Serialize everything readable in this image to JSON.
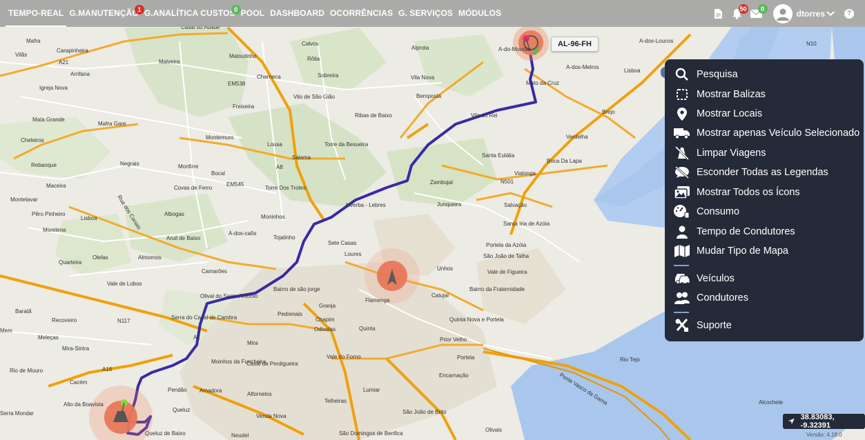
{
  "nav": {
    "items": [
      {
        "label": "TEMPO-REAL",
        "active": true
      },
      {
        "label": "G.MANUTENÇÃO",
        "badge": "1",
        "badge_color": "#d9302c"
      },
      {
        "label": "G.ANALÍTICA CUSTOS",
        "badge": "0",
        "badge_color": "#5cb85c"
      },
      {
        "label": "POOL"
      },
      {
        "label": "DASHBOARD"
      },
      {
        "label": "OCORRÊNCIAS"
      },
      {
        "label": "G. SERVIÇOS"
      },
      {
        "label": "MÓDULOS"
      }
    ]
  },
  "header": {
    "document_icon": "document-icon",
    "notifications": {
      "icon": "bell-icon",
      "badge": "50"
    },
    "messages": {
      "icon": "envelope-icon",
      "badge": "0"
    },
    "user": {
      "name": "dtorres"
    },
    "help": "?"
  },
  "side_menu": {
    "items": [
      {
        "icon": "search-icon",
        "label": "Pesquisa"
      },
      {
        "icon": "dashed-square-icon",
        "label": "Mostrar Balizas"
      },
      {
        "icon": "map-pin-icon",
        "label": "Mostrar Locais"
      },
      {
        "icon": "truck-icon",
        "label": "Mostrar apenas Veículo Selecionado"
      },
      {
        "icon": "road-off-icon",
        "label": "Limpar Viagens"
      },
      {
        "icon": "comment-off-icon",
        "label": "Esconder Todas as Legendas"
      },
      {
        "icon": "images-icon",
        "label": "Mostrar Todos os Ícons"
      },
      {
        "icon": "gauge-icon",
        "label": "Consumo"
      },
      {
        "icon": "person-icon",
        "label": "Tempo de Condutores"
      },
      {
        "icon": "map-icon",
        "label": "Mudar Tipo de Mapa"
      },
      {
        "icon": "car-icon",
        "label": "Veículos"
      },
      {
        "icon": "people-icon",
        "label": "Condutores"
      },
      {
        "icon": "tools-icon",
        "label": "Suporte"
      }
    ]
  },
  "map": {
    "vehicle_plate": "AL-96-FH",
    "coordinates": "38.83083, -9.32391",
    "attribution": "Versão: 4.18.0",
    "labels": {
      "Mafra": "Mafra",
      "Vilas": "Vilãs",
      "Carapinheira": "Carapinheira",
      "Malveira": "Malveira",
      "Matoutinho": "Matoutinho",
      "Calvos": "Calvos",
      "Rolia": "Rôlia",
      "Sobreira": "Sobreira",
      "Alprota": "Alprota",
      "ADoMourao": "A-do-Mourão",
      "ADosLoucos": "A-dos-Loucos",
      "ADosMelros": "A-dos-Melros",
      "Arrifana": "Arrifana",
      "IgrejaNova": "Igreja Nova",
      "Charneca": "Charneca",
      "VilaNova": "Vila Nova",
      "MatoDaCruz": "Mato da Cruz",
      "Bemposta": "Bemposta",
      "VilaDoRei": "Vila do Rei",
      "Brejo": "Brejo",
      "Freixeira": "Freixeira",
      "ViloDeSaoGiao": "Vilo de São Gião",
      "RibasDeBaixo": "Ribas de Baixo",
      "MataGrande": "Mata Grande",
      "MafraGare": "Mafra Gare",
      "Cheleiros": "Cheleiros",
      "Montemuro": "Montemuro",
      "Lousa": "Lousa",
      "TorreDaBesueira": "Torre da Besueira",
      "SantaEulalia": "Santa Eulália",
      "Verdelha": "Verdelha",
      "Rebanque": "Rebanque",
      "Negrais": "Negrais",
      "Monfirre": "Monfirre",
      "Bocal": "Bocal",
      "Salema": "Salema",
      "BocaDaLapa": "Boca Da Lapa",
      "Vialonga": "Vialonga",
      "Maceira": "Maceira",
      "CovasDeFerro": "Covas de Ferro",
      "TorreDosTrotes": "Torre Dos Trotes",
      "Zambujal": "Zambujal",
      "Montelavar": "Montelavar",
      "PeroPinheiro": "Pêro Pinheiro",
      "Albogas": "Albogas",
      "Moninhos": "Moninhos",
      "AlverbaLebres": "Alverba - Lebres",
      "Junqueira": "Junqueira",
      "Salvacao": "Salvação",
      "Morelena": "Morelena",
      "ADosCaos": "A-dos-caõs",
      "AruilDeBaixo": "Aruil de Baixo",
      "Tojalinho": "Tojalinho",
      "SantaIriaDeAzoia": "Santa Iria de Azóia",
      "SeteCasas": "Sete Casas",
      "PortelaDaAzoia": "Portela da Azóia",
      "Olelas": "Olelas",
      "Almornos": "Almornos",
      "Loures": "Loures",
      "Quarteira": "Quarteira",
      "Unhos": "Unhos",
      "SaoJoaoDeTalha": "São João de Talha",
      "ValeDeLobos": "Vale de Lobos",
      "Camaroes": "Camarões",
      "BairroDeSaoJorge": "Bairro de são jorge",
      "Flamenga": "Flamenga",
      "Catujal": "Catujal",
      "ValeDeFigueira": "Vale de Figueira",
      "BairroDaFraternidade": "Bairro da Fraternidade",
      "OlivalDeSantoAntonio": "Olival do Santo António",
      "Granja": "Granja",
      "Barata": "Baratã",
      "Recoveiro": "Recoveiro",
      "SerraDoCasalDeCambra": "Serra do Casal de Cambra",
      "Pedrenais": "Pedrenais",
      "Chapim": "Chapim",
      "QuintaNovaEPortela": "Quinta Nova e Portela",
      "Mem": "Mem",
      "Meleças": "Meleças",
      "MiraSintra": "Mira-Sintra",
      "Odivelas": "Odivelas",
      "Quinta": "Quinta",
      "PriorVelho": "Prior Velho",
      "Mira": "Mira",
      "ValeDoForno": "Vale do Forno",
      "Portela": "Portela",
      "RioTejo": "Rio Tejo",
      "RioDeMouro": "Rio de Mouro",
      "MoinhosDaFuncheira": "Moinhos da Funcheira",
      "CasalDaPerdigueira": "Casal da Perdigueira",
      "Encarnacao": "Encarnação",
      "Cacem": "Cacém",
      "Pendao": "Pendão",
      "Amadora": "Amadora",
      "Alfornelos": "Alfornelos",
      "Lumiar": "Lumiar",
      "AltoDaBoavista": "Alto da Boavista",
      "Telheiras": "Telheiras",
      "Alcochete": "Alcochete",
      "Queluz": "Queluz",
      "VendaNova": "Venda Nova",
      "SaoJoaoDeBrito": "São João de Brito",
      "PonteVascoDaGama": "Ponte Vasco da Gama",
      "QueluzDeBaixo": "Queluz de Baixo",
      "Neudel": "Neudel",
      "SaoDomingosDeBenfica": "São Domingos de Benfica",
      "Olivais": "Olivais",
      "SerraMondar": "Serra Mondar",
      "Lisboa": "Lisboa",
      "Lisbo2": "Lisboa",
      "A1": "A1",
      "A8": "A8",
      "A16": "A16",
      "A21": "A21",
      "N10": "N10",
      "N117": "N117",
      "N501": "N501",
      "EM538": "EM538",
      "EM545": "EM545",
      "RuaDosCanais": "Rua dos Canais",
      "CasalDoAbade": "Casal do Abade"
    }
  }
}
